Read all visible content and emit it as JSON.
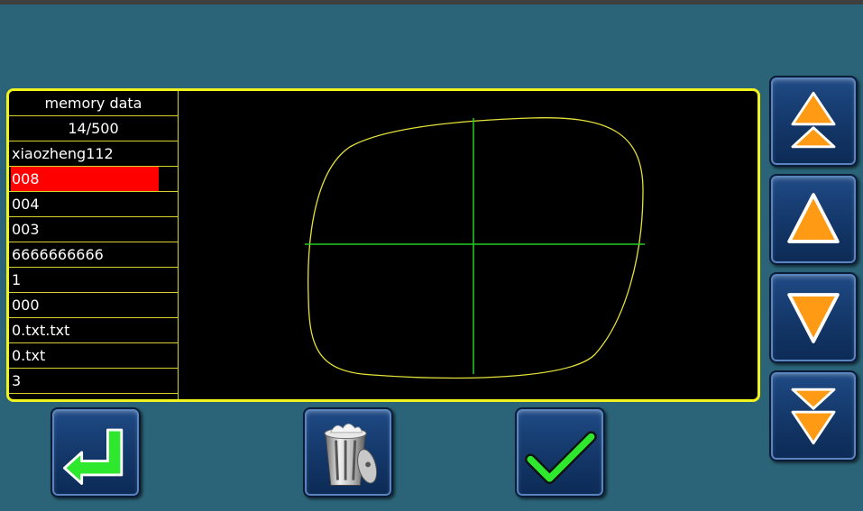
{
  "memory_list": {
    "header": "memory data",
    "count": "14/500",
    "items": [
      {
        "label": "xiaozheng112",
        "selected": false
      },
      {
        "label": "008",
        "selected": true
      },
      {
        "label": "004",
        "selected": false
      },
      {
        "label": "003",
        "selected": false
      },
      {
        "label": "6666666666",
        "selected": false
      },
      {
        "label": "1",
        "selected": false
      },
      {
        "label": "000",
        "selected": false
      },
      {
        "label": "0.txt.txt",
        "selected": false
      },
      {
        "label": "0.txt",
        "selected": false
      },
      {
        "label": "3",
        "selected": false
      }
    ]
  },
  "colors": {
    "background": "#2b6478",
    "panel_border": "#f2f21d",
    "selection": "#ff0000",
    "shape_outline": "#e6e23a",
    "crosshair": "#22cc22",
    "arrow_fill": "#ff9a14"
  },
  "icons": {
    "scroll_first": "double-up-arrow-icon",
    "scroll_up": "up-arrow-icon",
    "scroll_down": "down-arrow-icon",
    "scroll_last": "double-down-arrow-icon",
    "back": "return-arrow-icon",
    "delete": "trash-can-icon",
    "confirm": "checkmark-icon"
  }
}
